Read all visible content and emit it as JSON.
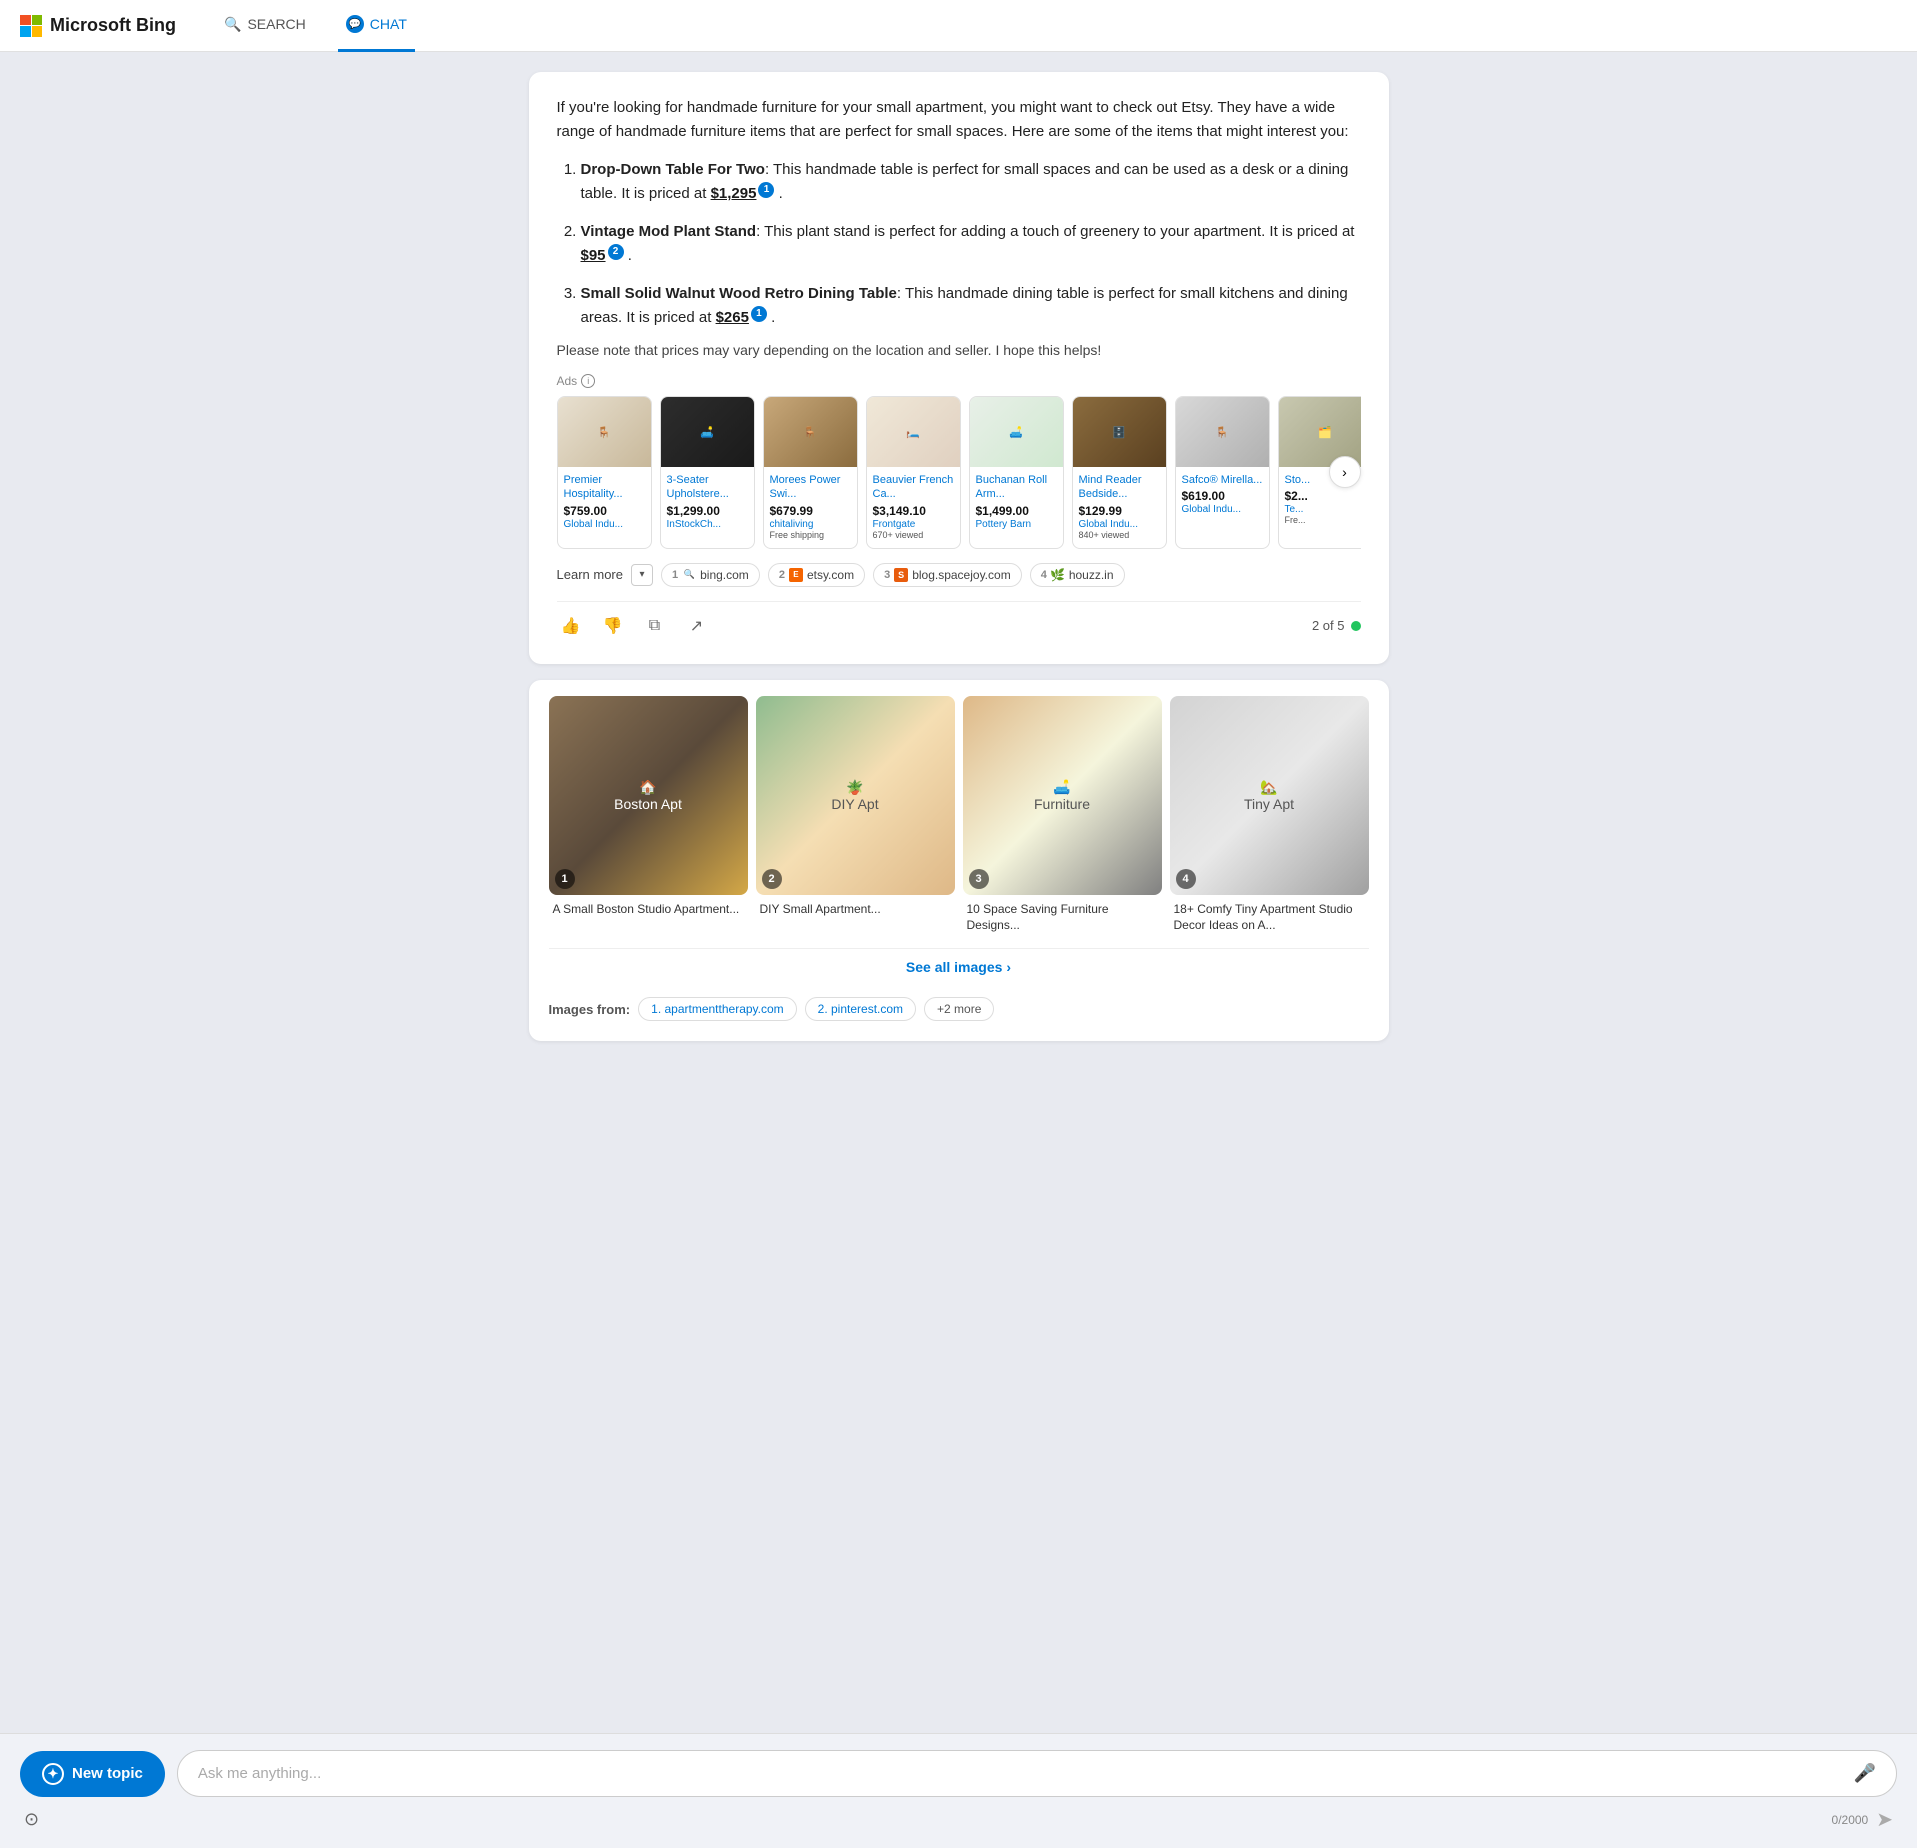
{
  "header": {
    "logo_text": "Microsoft Bing",
    "nav_search_label": "SEARCH",
    "nav_chat_label": "CHAT"
  },
  "chat": {
    "intro_text": "If you're looking for handmade furniture for your small apartment, you might want to check out Etsy. They have a wide range of handmade furniture items that are perfect for small spaces. Here are some of the items that might interest you:",
    "items": [
      {
        "name": "Drop-Down Table For Two",
        "desc": ": This handmade table is perfect for small spaces and can be used as a desk or a dining table. It is priced at ",
        "price": "$1,295",
        "cite": "1"
      },
      {
        "name": "Vintage Mod Plant Stand",
        "desc": ": This plant stand is perfect for adding a touch of greenery to your apartment. It is priced at ",
        "price": "$95",
        "cite": "2"
      },
      {
        "name": "Small Solid Walnut Wood Retro Dining Table",
        "desc": ": This handmade dining table is perfect for small kitchens and dining areas. It is priced at ",
        "price": "$265",
        "cite": "1"
      }
    ],
    "note": "Please note that prices may vary depending on the location and seller. I hope this helps!",
    "ads_label": "Ads",
    "ads": [
      {
        "name": "Premier Hospitality...",
        "price": "$759.00",
        "store": "Global Indu...",
        "extra": ""
      },
      {
        "name": "3-Seater Upholstere...",
        "price": "$1,299.00",
        "store": "InStockCh...",
        "extra": ""
      },
      {
        "name": "Morees Power Swi...",
        "price": "$679.99",
        "store": "chitaliving",
        "extra": "Free shipping"
      },
      {
        "name": "Beauvier French Ca...",
        "price": "$3,149.10",
        "store": "Frontgate",
        "extra": "670+ viewed"
      },
      {
        "name": "Buchanan Roll Arm...",
        "price": "$1,499.00",
        "store": "Pottery Barn",
        "extra": ""
      },
      {
        "name": "Mind Reader Bedside...",
        "price": "$129.99",
        "store": "Global Indu...",
        "extra": "840+ viewed"
      },
      {
        "name": "Safco® Mirella...",
        "price": "$619.00",
        "store": "Global Indu...",
        "extra": ""
      },
      {
        "name": "Sto...",
        "price": "$2...",
        "store": "Te...",
        "extra": "Fre..."
      }
    ],
    "learn_more_label": "Learn more",
    "sources": [
      {
        "num": "1",
        "icon_type": "search",
        "name": "bing.com"
      },
      {
        "num": "2",
        "icon_type": "etsy",
        "name": "etsy.com"
      },
      {
        "num": "3",
        "icon_type": "blog",
        "name": "blog.spacejoy.com"
      },
      {
        "num": "4",
        "icon_type": "houzz",
        "name": "houzz.in"
      }
    ],
    "response_count": "2 of 5",
    "thumbs_up_label": "thumbs up",
    "thumbs_down_label": "thumbs down",
    "copy_label": "copy",
    "share_label": "share"
  },
  "images_card": {
    "images": [
      {
        "num": "1",
        "caption": "A Small Boston Studio Apartment..."
      },
      {
        "num": "2",
        "caption": "DIY Small Apartment..."
      },
      {
        "num": "3",
        "caption": "10 Space Saving Furniture Designs..."
      },
      {
        "num": "4",
        "caption": "18+ Comfy Tiny Apartment Studio Decor Ideas on A..."
      }
    ],
    "see_all_label": "See all images",
    "images_from_label": "Images from:",
    "sources": [
      {
        "label": "1. apartmenttherapy.com"
      },
      {
        "label": "2. pinterest.com"
      },
      {
        "label": "+2 more"
      }
    ]
  },
  "bottom_bar": {
    "new_topic_label": "New topic",
    "input_placeholder": "Ask me anything...",
    "char_count": "0/2000"
  }
}
